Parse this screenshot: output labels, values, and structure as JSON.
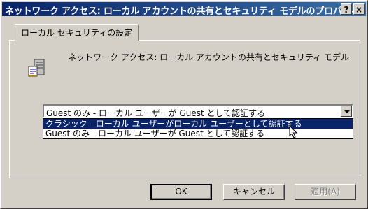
{
  "window": {
    "title": "ネットワーク アクセス: ローカル アカウントの共有とセキュリティ モデルのプロパティ",
    "help_button": "?",
    "close_button": "×"
  },
  "tab": {
    "label": "ローカル セキュリティの設定"
  },
  "policy": {
    "icon": "server-policy-icon",
    "name": "ネットワーク アクセス: ローカル アカウントの共有とセキュリティ モデル"
  },
  "combo": {
    "selected_value": "Guest のみ - ローカル ユーザーが Guest として認証する",
    "options": [
      "クラシック - ローカル ユーザーがローカル ユーザーとして認証する",
      "Guest のみ - ローカル ユーザーが Guest として認証する"
    ],
    "highlighted_index": 0
  },
  "buttons": {
    "ok": "OK",
    "cancel": "キャンセル",
    "apply": "適用(A)"
  },
  "colors": {
    "titlebar_start": "#0a246a",
    "titlebar_end": "#3a6ea5",
    "face": "#d4d0c8",
    "highlight": "#0a246a"
  }
}
